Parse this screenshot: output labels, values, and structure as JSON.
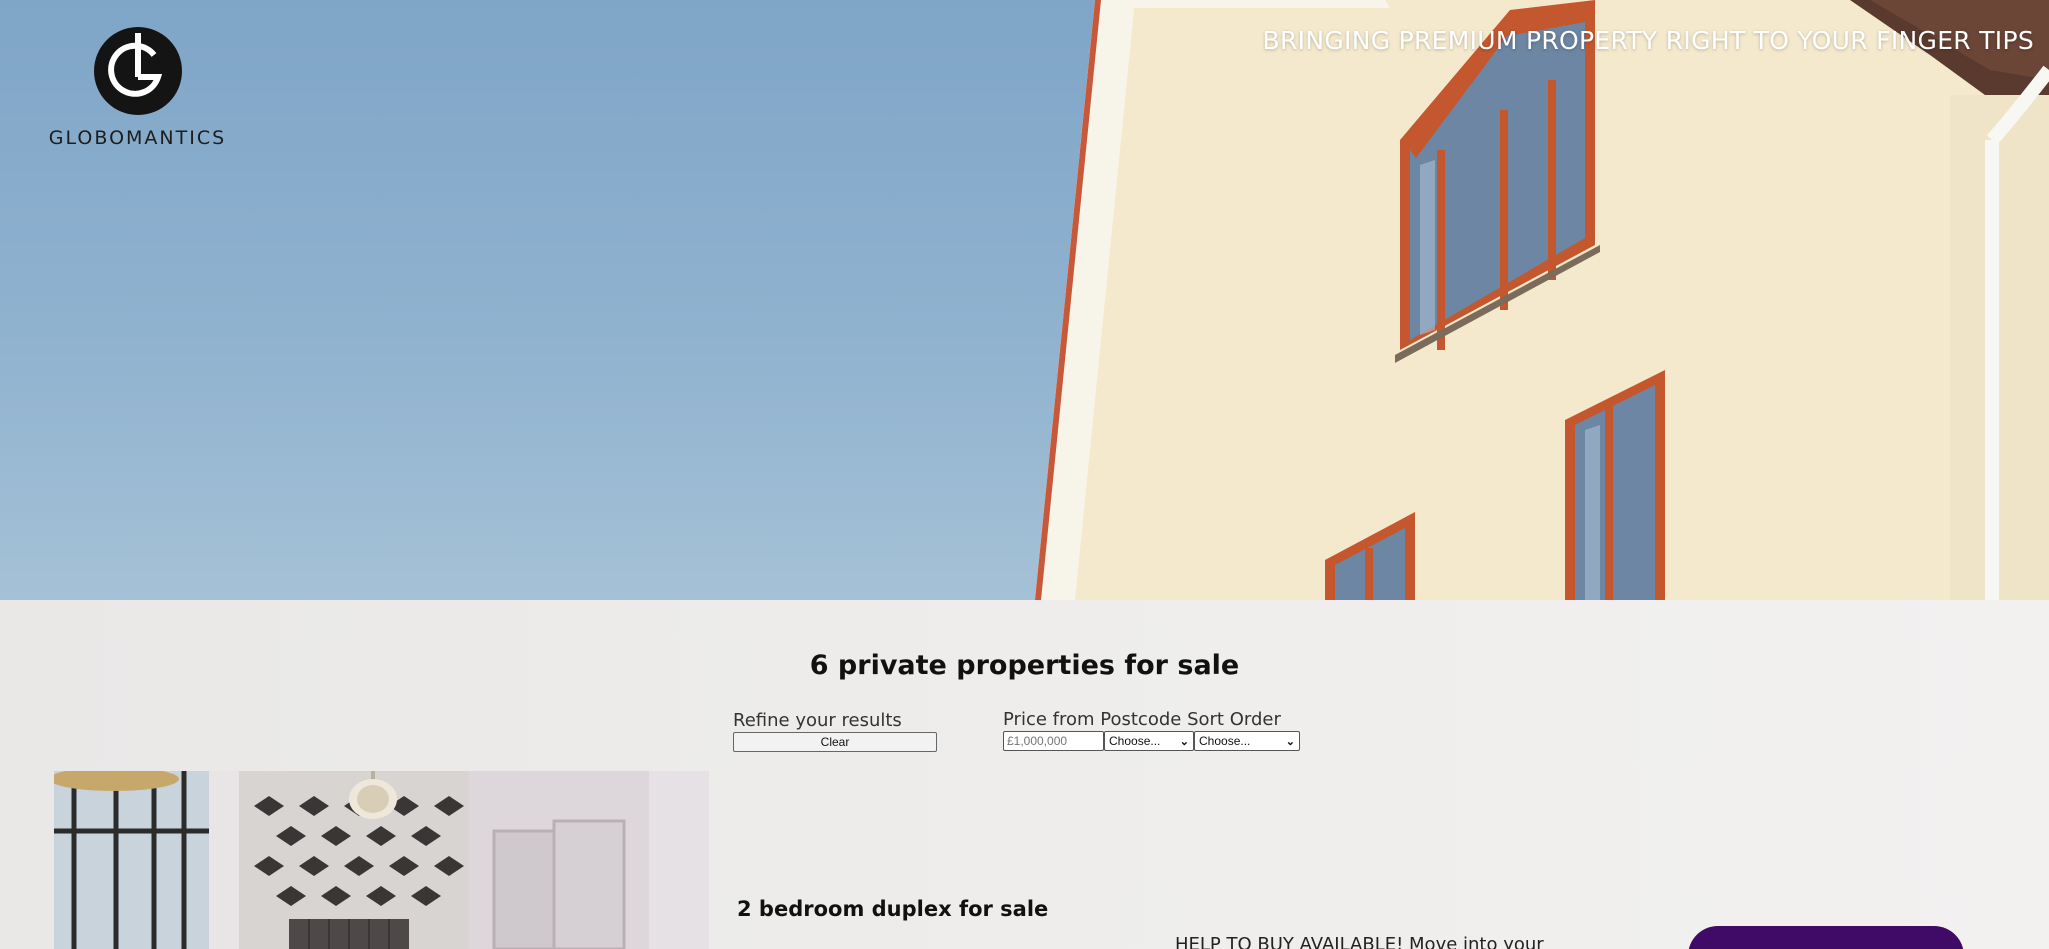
{
  "brand": {
    "name": "GLOBOMANTICS",
    "logo_icon": "globomantics-g-logo",
    "tagline": "BRINGING PREMIUM PROPERTY RIGHT TO YOUR FINGER TIPS"
  },
  "listing": {
    "heading": "6 private properties for sale",
    "refine": {
      "label": "Refine your results",
      "clear_label": "Clear"
    },
    "filters": {
      "price_label": "Price from",
      "postcode_label": "Postcode",
      "sort_label": "Sort Order",
      "price_placeholder": "£1,000,000",
      "postcode_selected": "Choose...",
      "sort_selected": "Choose..."
    },
    "cards": [
      {
        "title": "2 bedroom duplex for sale",
        "description": "HELP TO BUY AVAILABLE! Move into your"
      }
    ]
  },
  "colors": {
    "accent": "#3f0b66",
    "sky": "#8fb2cf",
    "house_wall": "#f3e8cc",
    "window_frame": "#c4572e",
    "page_bg": "#eeedeb"
  }
}
